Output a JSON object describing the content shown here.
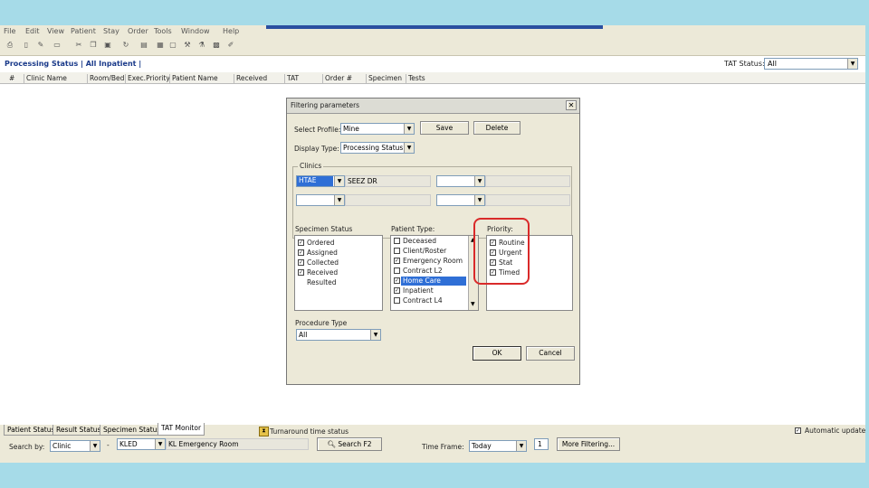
{
  "menu": [
    "File",
    "Edit",
    "View",
    "Patient",
    "Stay",
    "Order",
    "Tools",
    "Window",
    "Help"
  ],
  "processing_title": "Processing Status | All Inpatient |",
  "tat_status": {
    "label": "TAT Status:",
    "value": "All"
  },
  "columns": [
    "#",
    "Clinic Name",
    "Room/Bed",
    "Exec.Priority",
    "Patient Name",
    "Received",
    "TAT",
    "Order #",
    "Specimen",
    "Tests"
  ],
  "dialog": {
    "title": "Filtering parameters",
    "select_profile": {
      "label": "Select Profile:",
      "value": "Mine"
    },
    "save": "Save",
    "delete": "Delete",
    "display_type": {
      "label": "Display Type:",
      "value": "Processing Status"
    },
    "clinics": {
      "label": "Clinics",
      "first_code": "HTAE",
      "first_name": "SEEZ DR"
    },
    "specimen_status": {
      "label": "Specimen Status",
      "items": [
        {
          "text": "Ordered",
          "checked": true
        },
        {
          "text": "Assigned",
          "checked": true
        },
        {
          "text": "Collected",
          "checked": true
        },
        {
          "text": "Received",
          "checked": true
        },
        {
          "text": "Resulted",
          "checked": false
        }
      ]
    },
    "patient_type": {
      "label": "Patient Type:",
      "items": [
        {
          "text": "Deceased",
          "checked": false
        },
        {
          "text": "Client/Roster",
          "checked": false
        },
        {
          "text": "Emergency Room",
          "checked": true
        },
        {
          "text": "Contract L2",
          "checked": false
        },
        {
          "text": "Home Care",
          "checked": true
        },
        {
          "text": "Inpatient",
          "checked": true
        },
        {
          "text": "Contract L4",
          "checked": false
        }
      ]
    },
    "priority": {
      "label": "Priority:",
      "items": [
        {
          "text": "Routine",
          "checked": true
        },
        {
          "text": "Urgent",
          "checked": true
        },
        {
          "text": "Stat",
          "checked": true
        },
        {
          "text": "Timed",
          "checked": true
        }
      ]
    },
    "procedure_type": {
      "label": "Procedure Type",
      "value": "All"
    },
    "ok": "OK",
    "cancel": "Cancel"
  },
  "tabs": [
    "Patient Status",
    "Result Status",
    "Specimen Status",
    "TAT Monitor"
  ],
  "turnaround_label": "Turnaround time status",
  "auto_update": "Automatic update",
  "search": {
    "label": "Search by:",
    "by": "Clinic",
    "code": "KLED",
    "name": "KL Emergency Room",
    "button": "Search F2"
  },
  "time_frame": {
    "label": "Time Frame:",
    "value": "Today",
    "count": "1"
  },
  "more_filtering": "More Filtering...",
  "colors": {
    "highlight": "#2f6fd6",
    "annotation": "#d92a2a",
    "background": "#a6dbe8"
  }
}
